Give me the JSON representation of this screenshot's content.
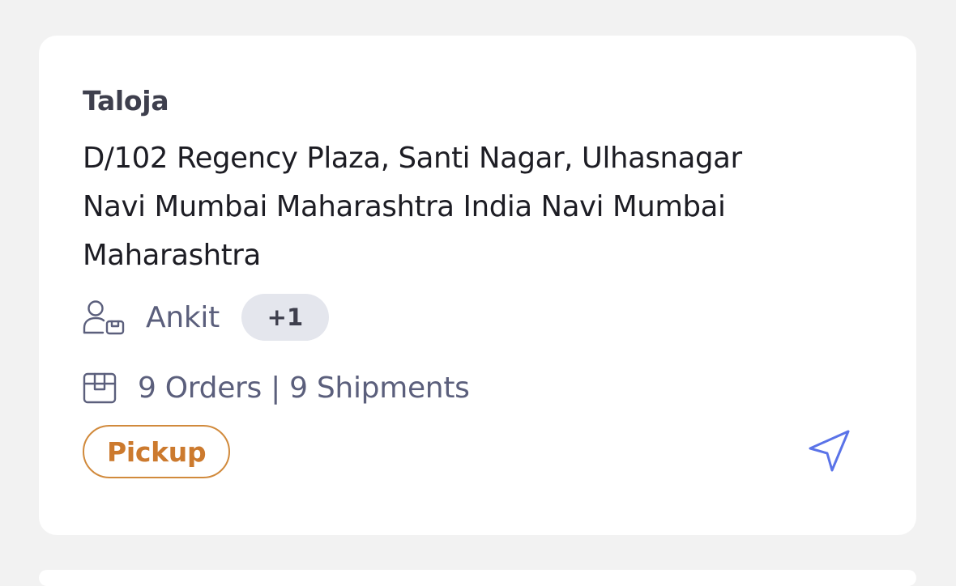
{
  "location": {
    "name": "Taloja",
    "address": "D/102 Regency Plaza, Santi Nagar, Ulhasnagar Navi Mumbai Maharashtra India Navi Mumbai Maharashtra"
  },
  "contact": {
    "icon": "user-box-icon",
    "name": "Ankit",
    "extra_count": "+1"
  },
  "orders": {
    "icon": "package-icon",
    "summary": "9 Orders | 9 Shipments"
  },
  "badge": {
    "label": "Pickup",
    "color": "#d18a3c"
  },
  "actions": {
    "navigate_icon": "navigation-arrow-icon",
    "accent_color": "#5a73e8"
  }
}
